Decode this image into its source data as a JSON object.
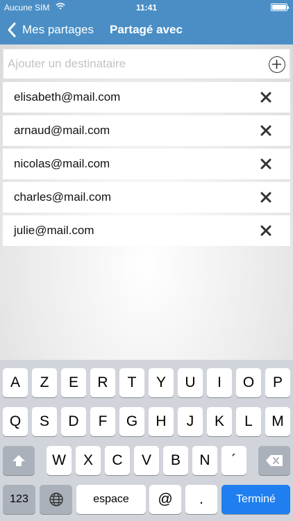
{
  "status_bar": {
    "carrier": "Aucune SIM",
    "time": "11:41"
  },
  "nav": {
    "back_label": "Mes partages",
    "title": "Partagé avec"
  },
  "add_recipient": {
    "placeholder": "Ajouter un destinataire"
  },
  "recipients": [
    "elisabeth@mail.com",
    "arnaud@mail.com",
    "nicolas@mail.com",
    "charles@mail.com",
    "julie@mail.com"
  ],
  "keyboard": {
    "row1": [
      "A",
      "Z",
      "E",
      "R",
      "T",
      "Y",
      "U",
      "I",
      "O",
      "P"
    ],
    "row2": [
      "Q",
      "S",
      "D",
      "F",
      "G",
      "H",
      "J",
      "K",
      "L",
      "M"
    ],
    "row3": [
      "W",
      "X",
      "C",
      "V",
      "B",
      "N",
      "´"
    ],
    "numbers_label": "123",
    "space_label": "espace",
    "at_label": "@",
    "dot_label": ".",
    "return_label": "Terminé"
  },
  "colors": {
    "nav_background": "#4a8ec5",
    "return_key": "#1f7ff0"
  }
}
